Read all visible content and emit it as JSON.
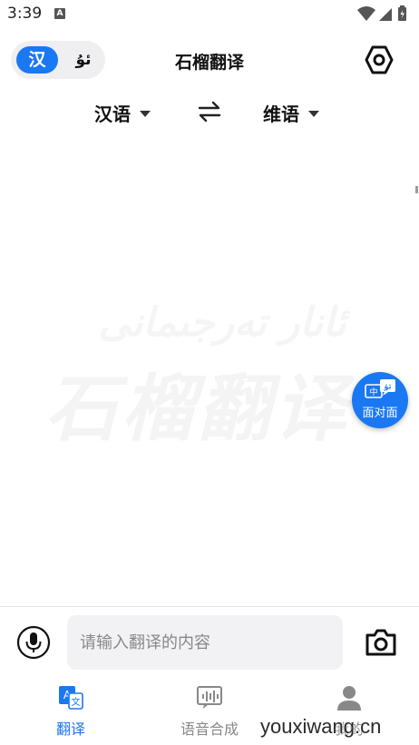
{
  "status_bar": {
    "time": "3:39",
    "notification_letter": "A"
  },
  "header": {
    "title": "石榴翻译",
    "toggle_active": "汉",
    "toggle_inactive": "ئۇ"
  },
  "language_bar": {
    "source": "汉语",
    "target": "维语"
  },
  "watermark": {
    "line1": "ئانار تەرجىمانى",
    "line2": "石榴翻译"
  },
  "fab": {
    "label": "面对面",
    "badge_zh": "中",
    "badge_ug": "ئۇ"
  },
  "input": {
    "value": "",
    "placeholder": "请输入翻译的内容"
  },
  "bottom_nav": {
    "items": [
      {
        "label": "翻译",
        "active": true
      },
      {
        "label": "语音合成",
        "active": false
      },
      {
        "label": "我的",
        "active": false
      }
    ]
  },
  "site_watermark": "youxiwang.cn",
  "colors": {
    "accent": "#1a78f2",
    "toggle_bg": "#efeff1",
    "input_bg": "#f2f2f4",
    "inactive_text": "#888888"
  }
}
